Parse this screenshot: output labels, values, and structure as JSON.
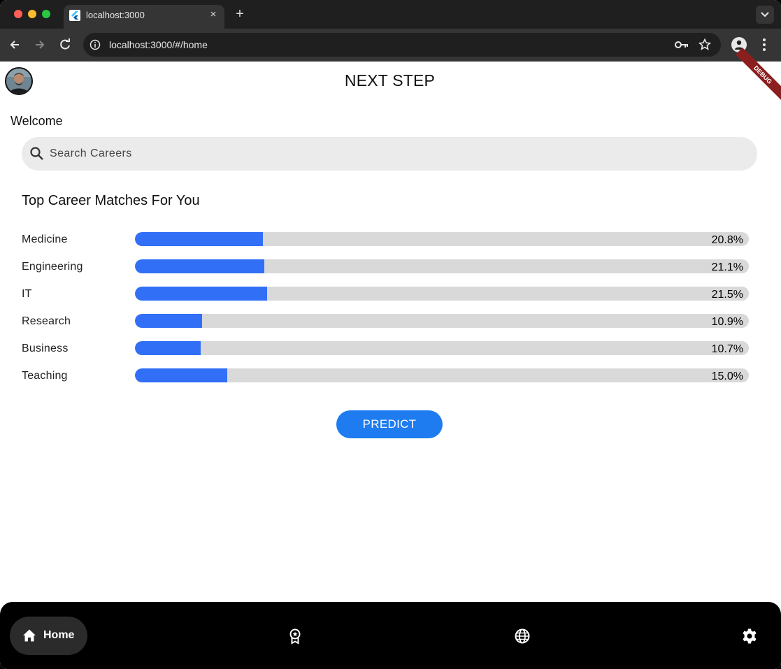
{
  "browser": {
    "tab_title": "localhost:3000",
    "url": "localhost:3000/#/home",
    "new_tab_label": "+",
    "tab_close_label": "×"
  },
  "app": {
    "title": "NEXT STEP",
    "debug_label": "DEBUG",
    "welcome": "Welcome",
    "search_placeholder": "Search Careers",
    "section_title": "Top Career Matches For You",
    "accent_color": "#316ff6",
    "careers": [
      {
        "label": "Medicine",
        "percent_text": "20.8%",
        "value": 20.8
      },
      {
        "label": "Engineering",
        "percent_text": "21.1%",
        "value": 21.1
      },
      {
        "label": "IT",
        "percent_text": "21.5%",
        "value": 21.5
      },
      {
        "label": "Research",
        "percent_text": "10.9%",
        "value": 10.9
      },
      {
        "label": "Business",
        "percent_text": "10.7%",
        "value": 10.7
      },
      {
        "label": "Teaching",
        "percent_text": "15.0%",
        "value": 15.0
      }
    ],
    "predict_label": "PREDICT"
  },
  "bottom_nav": {
    "items": [
      {
        "label": "Home",
        "icon": "home-icon",
        "active": true
      },
      {
        "icon": "award-icon"
      },
      {
        "icon": "globe-icon"
      },
      {
        "icon": "settings-icon"
      }
    ]
  }
}
